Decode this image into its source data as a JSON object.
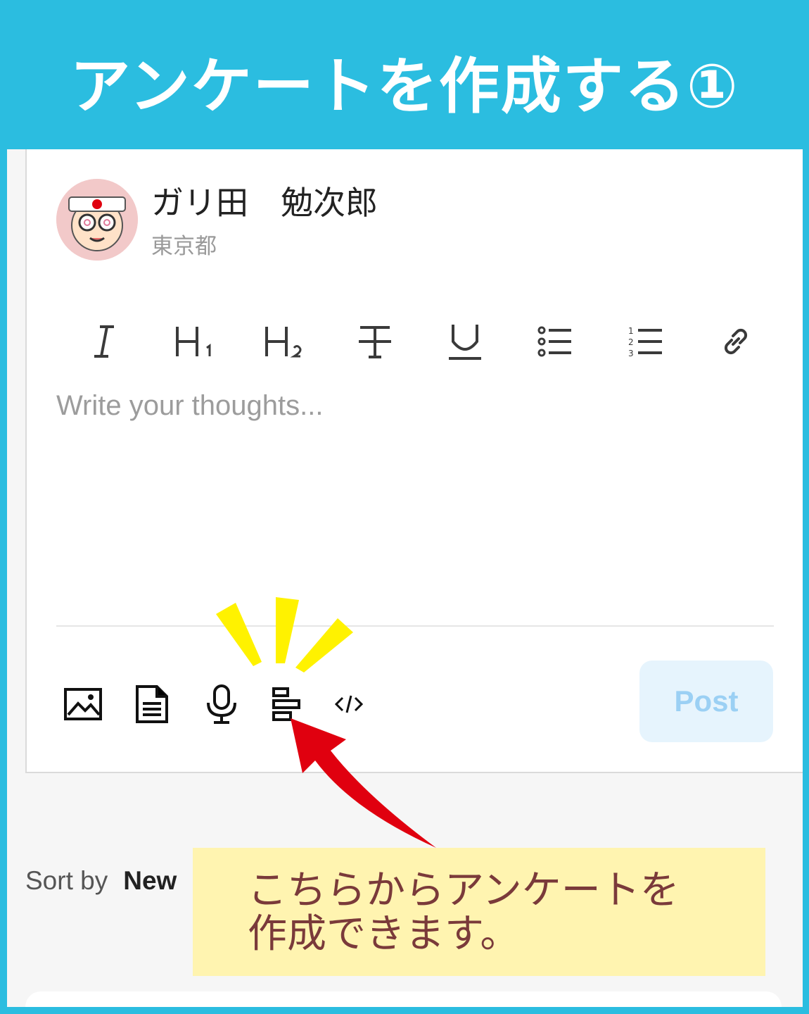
{
  "header": {
    "title": "アンケートを作成する①"
  },
  "user": {
    "name": "ガリ田　勉次郎",
    "location": "東京都"
  },
  "formatting_toolbar": {
    "items": [
      "italic-icon",
      "heading1-icon",
      "heading2-icon",
      "strikethrough-icon",
      "underline-icon",
      "bullet-list-icon",
      "numbered-list-icon",
      "link-icon"
    ]
  },
  "editor": {
    "placeholder": "Write your thoughts..."
  },
  "attachments": {
    "items": [
      "image-icon",
      "document-icon",
      "microphone-icon",
      "poll-icon",
      "code-icon"
    ]
  },
  "post_button": {
    "label": "Post"
  },
  "sort": {
    "label": "Sort by",
    "value": "New"
  },
  "callout": {
    "line1": "こちらからアンケートを",
    "line2": "作成できます。"
  },
  "colors": {
    "background": "#2BBDE0",
    "callout": "#FFF4B0",
    "arrow": "#E0000F",
    "sparkle": "#FFF200",
    "post_button_bg": "#E6F4FD"
  }
}
